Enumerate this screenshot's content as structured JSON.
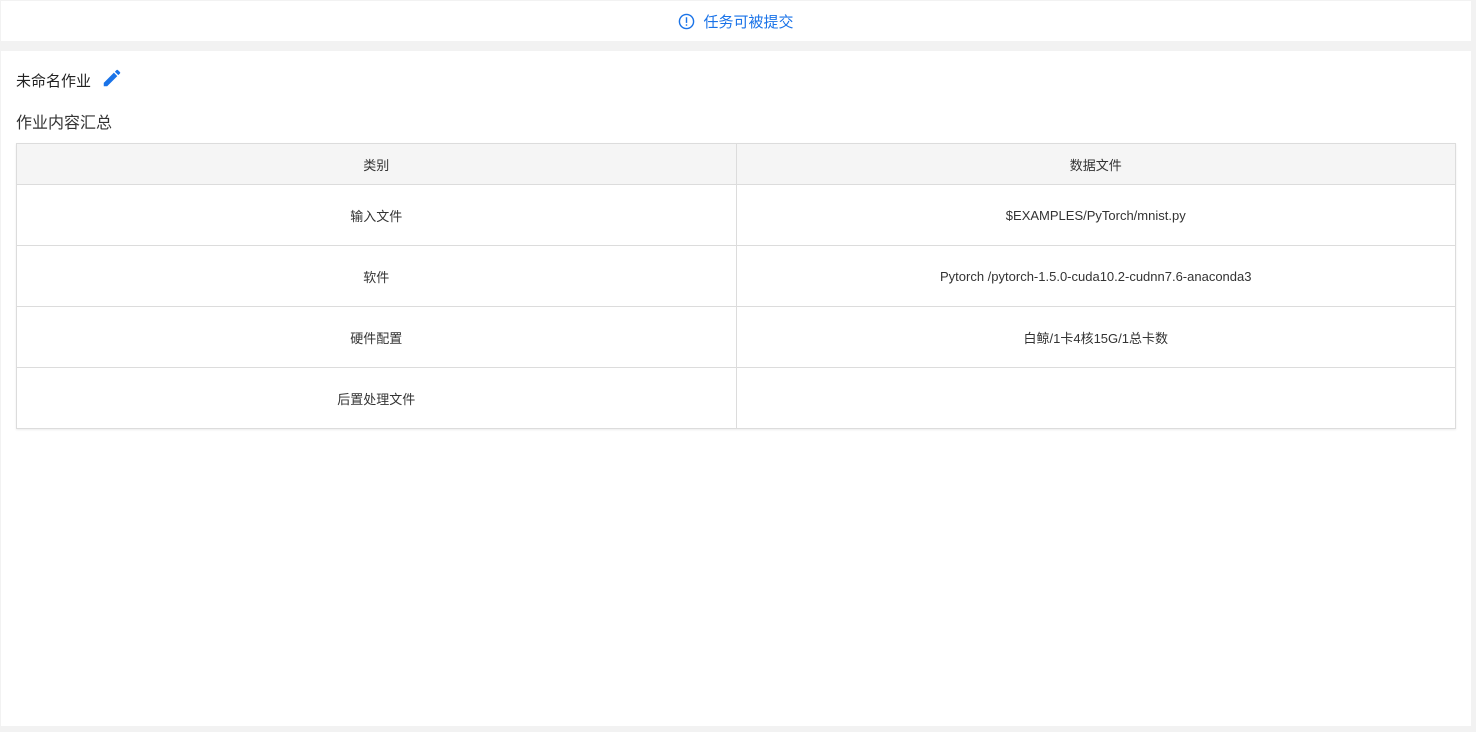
{
  "banner": {
    "icon": "alert-circle-icon",
    "text": "任务可被提交",
    "color": "#1a73e8"
  },
  "job": {
    "name": "未命名作业",
    "edit_icon": "pencil-icon"
  },
  "summary": {
    "title": "作业内容汇总",
    "columns": [
      "类别",
      "数据文件"
    ],
    "rows": [
      {
        "category": "输入文件",
        "value": "$EXAMPLES/PyTorch/mnist.py"
      },
      {
        "category": "软件",
        "value": "Pytorch /pytorch-1.5.0-cuda10.2-cudnn7.6-anaconda3"
      },
      {
        "category": "硬件配置",
        "value": "白鲸/1卡4核15G/1总卡数"
      },
      {
        "category": "后置处理文件",
        "value": ""
      }
    ]
  }
}
